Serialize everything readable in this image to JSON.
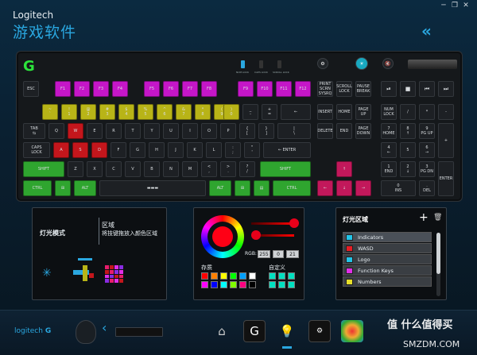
{
  "window": {
    "title": "Logitech",
    "subtitle": "游戏软件",
    "controls": [
      "─",
      "❐",
      "✕"
    ]
  },
  "keyboard": {
    "indicators": [
      "NUM LOCK",
      "CAPS LOCK",
      "SCROLL LOCK"
    ],
    "keys": [
      {
        "id": "esc",
        "label": "ESC",
        "color": "#1d2024"
      },
      {
        "id": "f1",
        "label": "F1",
        "color": "#c516c8"
      },
      {
        "id": "f2",
        "label": "F2",
        "color": "#c516c8"
      },
      {
        "id": "f3",
        "label": "F3",
        "color": "#c516c8"
      },
      {
        "id": "f4",
        "label": "F4",
        "color": "#c516c8"
      },
      {
        "id": "f5",
        "label": "F5",
        "color": "#c516c8"
      },
      {
        "id": "f6",
        "label": "F6",
        "color": "#c516c8"
      },
      {
        "id": "f7",
        "label": "F7",
        "color": "#c516c8"
      },
      {
        "id": "f8",
        "label": "F8",
        "color": "#c516c8"
      },
      {
        "id": "f9",
        "label": "F9",
        "color": "#c516c8"
      },
      {
        "id": "f10",
        "label": "F10",
        "color": "#c516c8"
      },
      {
        "id": "f11",
        "label": "F11",
        "color": "#c516c8"
      },
      {
        "id": "f12",
        "label": "F12",
        "color": "#c516c8"
      },
      {
        "id": "prt",
        "label": "PRINT\nSCRN\nSYSRQ",
        "color": "#1d2024"
      },
      {
        "id": "scr",
        "label": "SCROLL\nLOCK",
        "color": "#1d2024"
      },
      {
        "id": "pause",
        "label": "PAUSE\nBREAK",
        "color": "#1d2024"
      },
      {
        "id": "grave",
        "label": "~\n`",
        "color": "#b8b417"
      },
      {
        "id": "n1",
        "label": "!\n1",
        "color": "#b8b417"
      },
      {
        "id": "n2",
        "label": "@\n2",
        "color": "#b8b417"
      },
      {
        "id": "n3",
        "label": "#\n3",
        "color": "#b8b417"
      },
      {
        "id": "n4",
        "label": "$\n4",
        "color": "#b8b417"
      },
      {
        "id": "n5",
        "label": "%\n5",
        "color": "#b8b417"
      },
      {
        "id": "n6",
        "label": "^\n6",
        "color": "#b8b417"
      },
      {
        "id": "n7",
        "label": "&\n7",
        "color": "#b8b417"
      },
      {
        "id": "n8",
        "label": "*\n8",
        "color": "#b8b417"
      },
      {
        "id": "n9",
        "label": "(\n9",
        "color": "#b8b417"
      },
      {
        "id": "n0",
        "label": ")\n0",
        "color": "#b8b417"
      },
      {
        "id": "minus",
        "label": "_\n-",
        "color": "#1d2024"
      },
      {
        "id": "plus",
        "label": "+\n=",
        "color": "#1d2024"
      },
      {
        "id": "bksp",
        "label": "←",
        "color": "#1d2024"
      },
      {
        "id": "ins",
        "label": "INSERT",
        "color": "#1d2024"
      },
      {
        "id": "home",
        "label": "HOME",
        "color": "#1d2024"
      },
      {
        "id": "pgup",
        "label": "PAGE\nUP",
        "color": "#1d2024"
      },
      {
        "id": "numlk",
        "label": "NUM\nLOCK",
        "color": "#1d2024"
      },
      {
        "id": "div",
        "label": "/",
        "color": "#1d2024"
      },
      {
        "id": "mul",
        "label": "*",
        "color": "#1d2024"
      },
      {
        "id": "sub",
        "label": "-",
        "color": "#1d2024"
      },
      {
        "id": "tab",
        "label": "TAB\n⇆",
        "color": "#1d2024"
      },
      {
        "id": "q",
        "label": "Q",
        "color": "#1d2024"
      },
      {
        "id": "w",
        "label": "W",
        "color": "#c4161c"
      },
      {
        "id": "e",
        "label": "E",
        "color": "#1d2024"
      },
      {
        "id": "r",
        "label": "R",
        "color": "#1d2024"
      },
      {
        "id": "t",
        "label": "T",
        "color": "#1d2024"
      },
      {
        "id": "y",
        "label": "Y",
        "color": "#1d2024"
      },
      {
        "id": "u",
        "label": "U",
        "color": "#1d2024"
      },
      {
        "id": "i",
        "label": "I",
        "color": "#1d2024"
      },
      {
        "id": "o",
        "label": "O",
        "color": "#1d2024"
      },
      {
        "id": "p",
        "label": "P",
        "color": "#1d2024"
      },
      {
        "id": "lbr",
        "label": "{\n[",
        "color": "#1d2024"
      },
      {
        "id": "rbr",
        "label": "}\n]",
        "color": "#1d2024"
      },
      {
        "id": "bsl",
        "label": "|\n\\",
        "color": "#1d2024"
      },
      {
        "id": "del",
        "label": "DELETE",
        "color": "#1d2024"
      },
      {
        "id": "end",
        "label": "END",
        "color": "#1d2024"
      },
      {
        "id": "pgdn",
        "label": "PAGE\nDOWN",
        "color": "#1d2024"
      },
      {
        "id": "np7",
        "label": "7\nHOME",
        "color": "#1d2024"
      },
      {
        "id": "np8",
        "label": "8\n↑",
        "color": "#1d2024"
      },
      {
        "id": "np9",
        "label": "9\nPG UP",
        "color": "#1d2024"
      },
      {
        "id": "npplus",
        "label": "+",
        "color": "#1d2024"
      },
      {
        "id": "caps",
        "label": "CAPS\nLOCK",
        "color": "#1d2024"
      },
      {
        "id": "a",
        "label": "A",
        "color": "#c4161c"
      },
      {
        "id": "s",
        "label": "S",
        "color": "#c4161c"
      },
      {
        "id": "d",
        "label": "D",
        "color": "#c4161c"
      },
      {
        "id": "f",
        "label": "F",
        "color": "#1d2024"
      },
      {
        "id": "g",
        "label": "G",
        "color": "#1d2024"
      },
      {
        "id": "h",
        "label": "H",
        "color": "#1d2024"
      },
      {
        "id": "j",
        "label": "J",
        "color": "#1d2024"
      },
      {
        "id": "k",
        "label": "K",
        "color": "#1d2024"
      },
      {
        "id": "l",
        "label": "L",
        "color": "#1d2024"
      },
      {
        "id": "semi",
        "label": ":\n;",
        "color": "#1d2024"
      },
      {
        "id": "quote",
        "label": "\"\n'",
        "color": "#1d2024"
      },
      {
        "id": "enter",
        "label": "← ENTER",
        "color": "#1d2024"
      },
      {
        "id": "np4",
        "label": "4\n←",
        "color": "#1d2024"
      },
      {
        "id": "np5",
        "label": "5",
        "color": "#1d2024"
      },
      {
        "id": "np6",
        "label": "6\n→",
        "color": "#1d2024"
      },
      {
        "id": "lshift",
        "label": "SHIFT",
        "color": "#2fa52f"
      },
      {
        "id": "z",
        "label": "Z",
        "color": "#1d2024"
      },
      {
        "id": "x",
        "label": "X",
        "color": "#1d2024"
      },
      {
        "id": "c",
        "label": "C",
        "color": "#1d2024"
      },
      {
        "id": "v",
        "label": "V",
        "color": "#1d2024"
      },
      {
        "id": "b",
        "label": "B",
        "color": "#1d2024"
      },
      {
        "id": "n",
        "label": "N",
        "color": "#1d2024"
      },
      {
        "id": "m",
        "label": "M",
        "color": "#1d2024"
      },
      {
        "id": "comma",
        "label": "<\n,",
        "color": "#1d2024"
      },
      {
        "id": "dot",
        "label": ">\n.",
        "color": "#1d2024"
      },
      {
        "id": "slash",
        "label": "?\n/",
        "color": "#1d2024"
      },
      {
        "id": "rshift",
        "label": "SHIFT",
        "color": "#2fa52f"
      },
      {
        "id": "up",
        "label": "↑",
        "color": "#c2185b"
      },
      {
        "id": "np1",
        "label": "1\nEND",
        "color": "#1d2024"
      },
      {
        "id": "np2",
        "label": "2\n↓",
        "color": "#1d2024"
      },
      {
        "id": "np3",
        "label": "3\nPG DN",
        "color": "#1d2024"
      },
      {
        "id": "npent",
        "label": "ENTER",
        "color": "#1d2024"
      },
      {
        "id": "lctrl",
        "label": "CTRL",
        "color": "#2fa52f"
      },
      {
        "id": "lwin",
        "label": "⊞",
        "color": "#2fa52f"
      },
      {
        "id": "lalt",
        "label": "ALT",
        "color": "#2fa52f"
      },
      {
        "id": "space",
        "label": "▬▬▬",
        "color": "#1d2024"
      },
      {
        "id": "ralt",
        "label": "ALT",
        "color": "#2fa52f"
      },
      {
        "id": "rwin",
        "label": "⊞",
        "color": "#2fa52f"
      },
      {
        "id": "menu",
        "label": "▤",
        "color": "#2fa52f"
      },
      {
        "id": "rctrl",
        "label": "CTRL",
        "color": "#2fa52f"
      },
      {
        "id": "left",
        "label": "←",
        "color": "#c2185b"
      },
      {
        "id": "down",
        "label": "↓",
        "color": "#c2185b"
      },
      {
        "id": "right",
        "label": "→",
        "color": "#c2185b"
      },
      {
        "id": "np0",
        "label": "0\nINS",
        "color": "#1d2024"
      },
      {
        "id": "npdot",
        "label": ".\nDEL",
        "color": "#1d2024"
      }
    ],
    "media": [
      "⏯",
      "■",
      "⏮",
      "⏭"
    ]
  },
  "lighting_mode": {
    "label": "灯光模式",
    "region_title": "区域",
    "region_desc": "将技键拖放入颜色区域"
  },
  "color_picker": {
    "rgb_label": "RGB:",
    "r": "255",
    "g": "0",
    "b": "21",
    "preset_label": "存质",
    "custom_label": "自定义",
    "presets": [
      "#ff0000",
      "#ff8000",
      "#ffff00",
      "#00ff00",
      "#00a0ff",
      "#ffffff",
      "#ff00ff",
      "#0000ff",
      "#00ffff",
      "#80ff00",
      "#ff0080",
      "#000000"
    ],
    "custom": [
      "#00e0c0",
      "#00e0c0",
      "#00e0c0",
      "#00e0c0",
      "#00e0c0",
      "#00e0c0"
    ]
  },
  "zones": {
    "title": "灯光区域",
    "add": "+",
    "delete": "🗑",
    "items": [
      {
        "name": "Indicators",
        "color": "#22c4e8"
      },
      {
        "name": "WASD",
        "color": "#e81c24"
      },
      {
        "name": "Logo",
        "color": "#22c4e8"
      },
      {
        "name": "Function Keys",
        "color": "#e22ee8"
      },
      {
        "name": "Numbers",
        "color": "#e8e02a"
      }
    ]
  },
  "bottom": {
    "brand": "logitech",
    "watermark": "值 什么值得买",
    "watermark_url": "SMZDM.COM"
  }
}
